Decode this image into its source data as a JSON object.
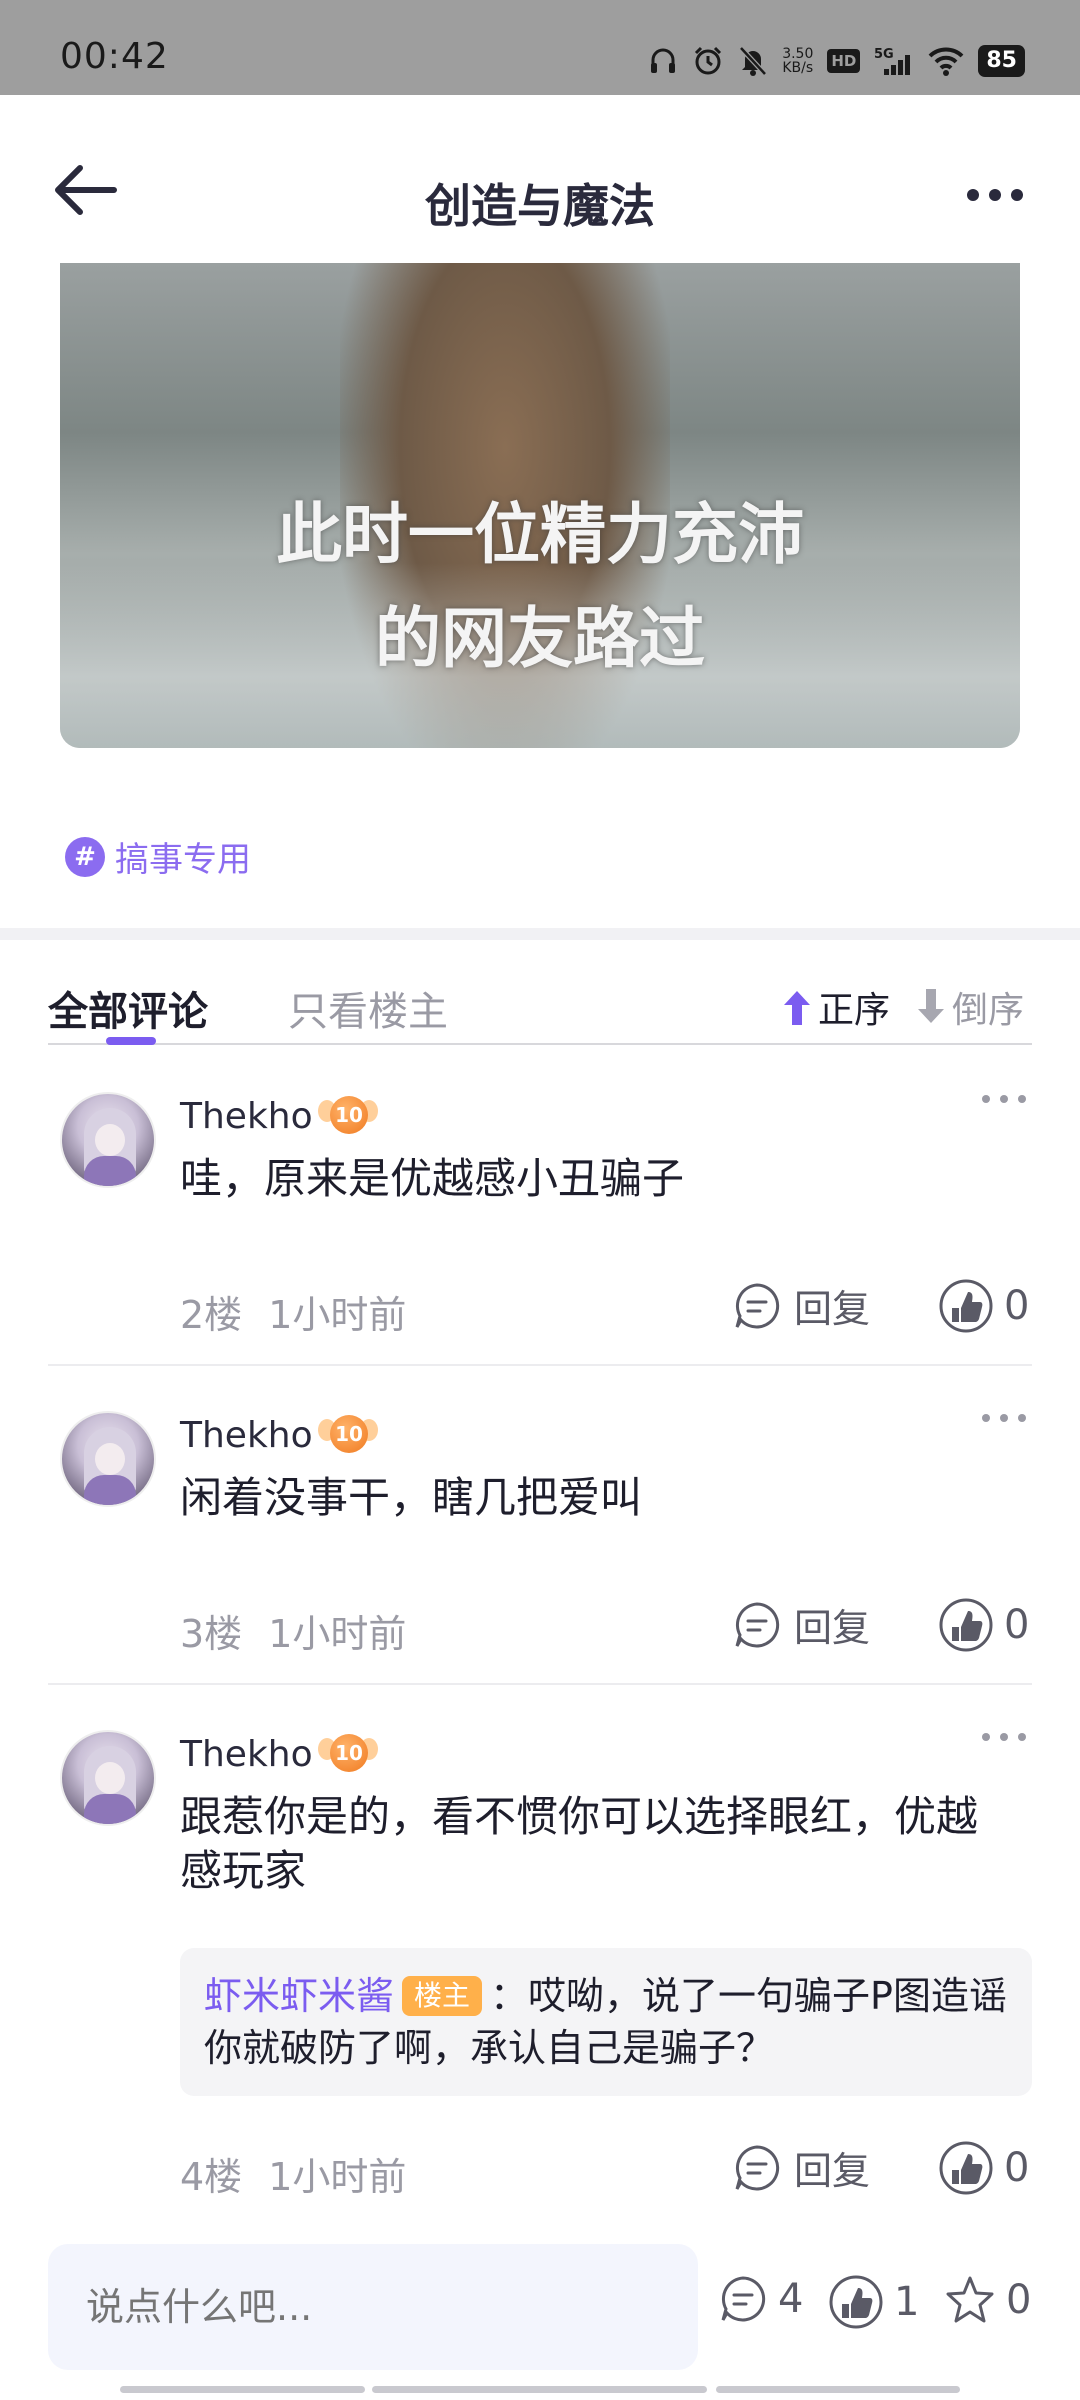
{
  "status_bar": {
    "time": "00:42",
    "net_speed_value": "3.50",
    "net_speed_unit": "KB/s",
    "hd_label": "HD",
    "network_label": "5G",
    "battery": "85"
  },
  "header": {
    "title": "创造与魔法",
    "back_icon": "arrow-left-icon",
    "more_icon": "more-dots-icon"
  },
  "post": {
    "image_caption_line1": "此时一位精力充沛",
    "image_caption_line2": "的网友路过",
    "topic_tag_symbol": "#",
    "topic_tag": "搞事专用"
  },
  "tabs": {
    "all_comments": "全部评论",
    "owner_only": "只看楼主",
    "sort_asc": "正序",
    "sort_desc": "倒序",
    "active_tab": "全部评论",
    "active_sort": "正序"
  },
  "comments": [
    {
      "username": "Thekho",
      "level": "10",
      "text": "哇，原来是优越感小丑骗子",
      "floor": "2楼",
      "time": "1小时前",
      "reply_label": "回复",
      "likes": "0"
    },
    {
      "username": "Thekho",
      "level": "10",
      "text": "闲着没事干，瞎几把爱叫",
      "floor": "3楼",
      "time": "1小时前",
      "reply_label": "回复",
      "likes": "0"
    },
    {
      "username": "Thekho",
      "level": "10",
      "text": "跟惹你是的，看不惯你可以选择眼红，优越感玩家",
      "floor": "4楼",
      "time": "1小时前",
      "reply_label": "回复",
      "likes": "0",
      "sub_reply": {
        "username": "虾米虾米酱",
        "badge": "楼主",
        "separator": "：",
        "text": "哎呦，说了一句骗子P图造谣你就破防了啊，承认自己是骗子？"
      }
    }
  ],
  "bottom_bar": {
    "input_placeholder": "说点什么吧...",
    "comment_count": "4",
    "like_count": "1",
    "favorite_count": "0"
  },
  "colors": {
    "accent": "#7b5cf0",
    "tag": "#8b6cf0",
    "badge_orange": "#ffb04a",
    "status_bar": "#9e9e9e"
  }
}
